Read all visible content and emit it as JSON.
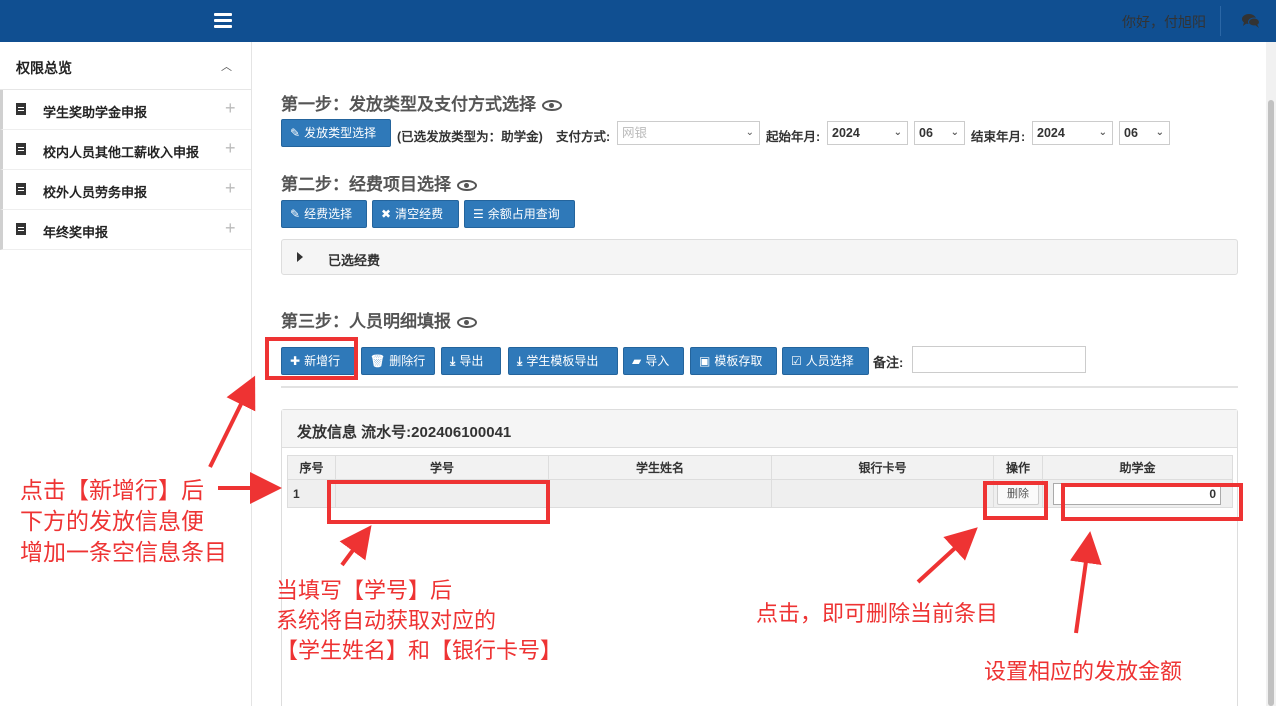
{
  "topbar": {
    "greeting": "你好，付旭阳",
    "menu_icon": "hamburger-icon",
    "chat_icon": "comments-icon"
  },
  "sidebar": {
    "header": "权限总览",
    "items": [
      {
        "label": "学生奖助学金申报"
      },
      {
        "label": "校内人员其他工薪收入申报"
      },
      {
        "label": "校外人员劳务申报"
      },
      {
        "label": "年终奖申报"
      }
    ]
  },
  "step1": {
    "title": "第一步：发放类型及支付方式选择",
    "type_button": "发放类型选择",
    "selected_text": "(已选发放类型为：助学金)",
    "pay_label": "支付方式:",
    "pay_value": "网银",
    "start_label": "起始年月:",
    "start_year": "2024",
    "start_month": "06",
    "end_label": "结束年月:",
    "end_year": "2024",
    "end_month": "06"
  },
  "step2": {
    "title": "第二步：经费项目选择",
    "buttons": {
      "select": "经费选择",
      "clear": "清空经费",
      "query": "余额占用查询"
    },
    "selected_funds": "已选经费"
  },
  "step3": {
    "title": "第三步：人员明细填报",
    "buttons": {
      "add_row": "新增行",
      "delete_row": "删除行",
      "export": "导出",
      "template_export": "学生模板导出",
      "import": "导入",
      "template_save": "模板存取",
      "select_person": "人员选择"
    },
    "remark_label": "备注:"
  },
  "panel": {
    "title": "发放信息 流水号:202406100041",
    "columns": [
      "序号",
      "学号",
      "学生姓名",
      "银行卡号",
      "操作",
      "助学金"
    ],
    "rows": [
      {
        "index": "1",
        "delete": "删除",
        "amount": "0"
      }
    ]
  },
  "annotations": {
    "a1": [
      "点击【新增行】后",
      "下方的发放信息便",
      "增加一条空信息条目"
    ],
    "a2": [
      "当填写【学号】后",
      "系统将自动获取对应的",
      "【学生姓名】和【银行卡号】"
    ],
    "a3": "点击，即可删除当前条目",
    "a4": "设置相应的发放金额"
  },
  "colors": {
    "topbar": "#104f91",
    "button": "#2f79b9",
    "annotation": "#ee3333"
  }
}
